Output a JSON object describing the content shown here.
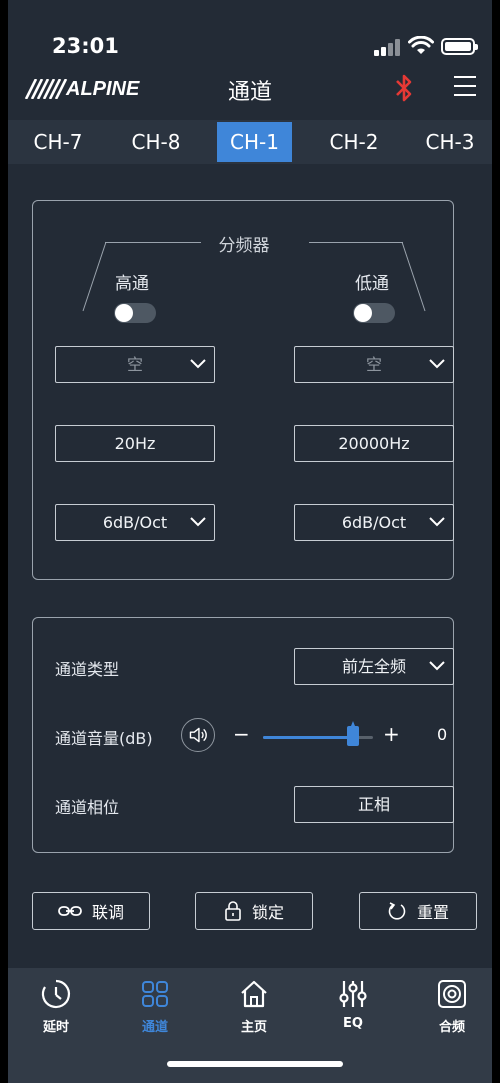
{
  "status_bar": {
    "time": "23:01"
  },
  "header": {
    "brand": "ALPINE",
    "title": "通道"
  },
  "tabs": [
    {
      "label": "CH-7",
      "active": false
    },
    {
      "label": "CH-8",
      "active": false
    },
    {
      "label": "CH-1",
      "active": true
    },
    {
      "label": "CH-2",
      "active": false
    },
    {
      "label": "CH-3",
      "active": false
    }
  ],
  "crossover": {
    "title": "分频器",
    "highpass": {
      "label": "高通",
      "enabled": false,
      "type": "空",
      "frequency": "20Hz",
      "slope": "6dB/Oct"
    },
    "lowpass": {
      "label": "低通",
      "enabled": false,
      "type": "空",
      "frequency": "20000Hz",
      "slope": "6dB/Oct"
    }
  },
  "channel": {
    "type_label": "通道类型",
    "type_value": "前左全频",
    "volume_label": "通道音量(dB)",
    "volume_minus": "−",
    "volume_plus": "+",
    "volume_value": "0",
    "volume_fraction": 0.82,
    "phase_label": "通道相位",
    "phase_value": "正相"
  },
  "actions": {
    "link": "联调",
    "lock": "锁定",
    "reset": "重置"
  },
  "nav": {
    "items": [
      {
        "label": "延时",
        "icon": "clock-icon",
        "active": false
      },
      {
        "label": "通道",
        "icon": "grid-icon",
        "active": true
      },
      {
        "label": "主页",
        "icon": "home-icon",
        "active": false
      },
      {
        "label": "EQ",
        "icon": "sliders-icon",
        "active": false
      },
      {
        "label": "合频",
        "icon": "speaker-icon",
        "active": false
      }
    ]
  },
  "colors": {
    "accent": "#3f86d9",
    "background": "#232b36",
    "bluetooth": "#e53935"
  }
}
